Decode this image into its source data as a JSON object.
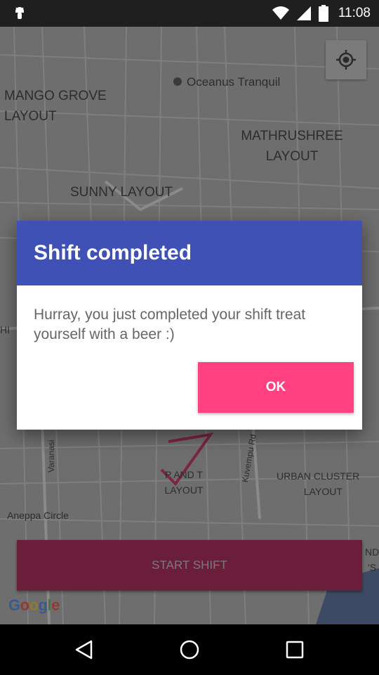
{
  "status_bar": {
    "time": "11:08",
    "icons": [
      "android-debug-icon",
      "wifi-icon",
      "signal-icon",
      "battery-icon"
    ]
  },
  "map": {
    "labels": [
      {
        "text": "MANGO GROVE\nLAYOUT"
      },
      {
        "text": "MATHRUSHREE\nLAYOUT"
      },
      {
        "text": "SUNNY LAYOUT"
      },
      {
        "text": "P AND T\nLAYOUT"
      },
      {
        "text": "URBAN CLUSTER\nLAYOUT"
      },
      {
        "text": "Aneppa Circle"
      },
      {
        "text": "Kuvempu Rd"
      },
      {
        "text": "Varanasi"
      },
      {
        "text": "HI"
      },
      {
        "text": "ND"
      }
    ],
    "poi": {
      "text": "Oceanus Tranquil"
    },
    "google_logo": "Google",
    "start_shift_label": "START SHIFT"
  },
  "dialog": {
    "title": "Shift completed",
    "message": "Hurray, you just completed your shift treat yourself with a beer :)",
    "ok_label": "OK"
  },
  "colors": {
    "dialog_header": "#3f51b5",
    "ok_button": "#ff4081",
    "start_shift_bg": "#6b1e3a"
  }
}
